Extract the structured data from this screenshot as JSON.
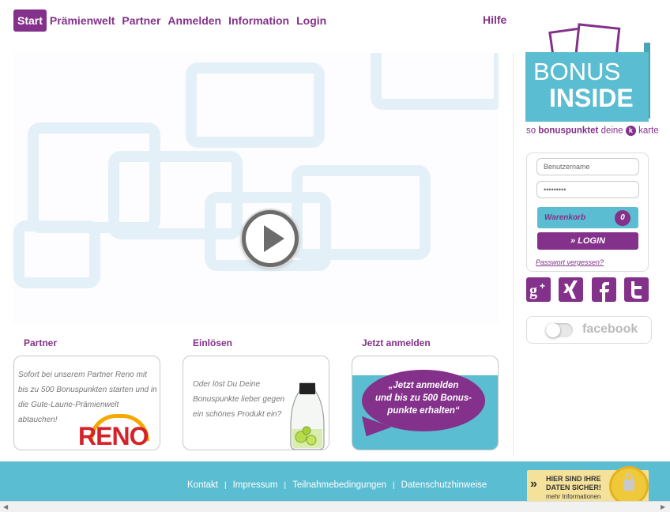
{
  "nav": {
    "items": [
      {
        "label": "Start",
        "active": true
      },
      {
        "label": "Prämienwelt"
      },
      {
        "label": "Partner"
      },
      {
        "label": "Anmelden"
      },
      {
        "label": "Information"
      },
      {
        "label": "Login"
      }
    ],
    "help": "Hilfe"
  },
  "teasers": {
    "partner": {
      "title": "Partner",
      "text": "Sofort bei unserem Partner Reno mit bis zu 500 Bonuspunkten starten und in die Gute-Laune-Prämienwelt abtauchen!",
      "logo_text": "RENO"
    },
    "einloesen": {
      "title": "Einlösen",
      "text": "Oder löst Du Deine Bonuspunkte lieber gegen ein schönes Produkt ein?"
    },
    "anmelden": {
      "title": "Jetzt anmelden",
      "bubble": "„Jetzt anmelden\nund bis zu 500 Bonus-\npunkte erhalten“"
    }
  },
  "logo": {
    "line1": "BONUS",
    "line2": "INSIDE",
    "sub_pre": "so ",
    "sub_bold": "bonuspunktet",
    "sub_mid": " deine ",
    "sub_k": "k",
    "sub_post": " karte"
  },
  "login": {
    "username_placeholder": "Benutzername",
    "password_value": "•••••••••",
    "cart_label": "Warenkorb",
    "cart_count": "0",
    "login_button": "» LOGIN",
    "forgot": "Passwort vergessen?"
  },
  "social": {
    "items": [
      "google-plus",
      "xing",
      "facebook",
      "twitter"
    ]
  },
  "facebook_toggle": {
    "label": "facebook",
    "on": false
  },
  "footer": {
    "links": [
      "Kontakt",
      "Impressum",
      "Teilnahmebedingungen",
      "Datenschutzhinweise"
    ],
    "secure_line1": "HIER SIND IHRE",
    "secure_line2": "DATEN SICHER!",
    "secure_more": "mehr Informationen"
  },
  "colors": {
    "accent": "#83318a",
    "teal": "#5bbdd1"
  }
}
